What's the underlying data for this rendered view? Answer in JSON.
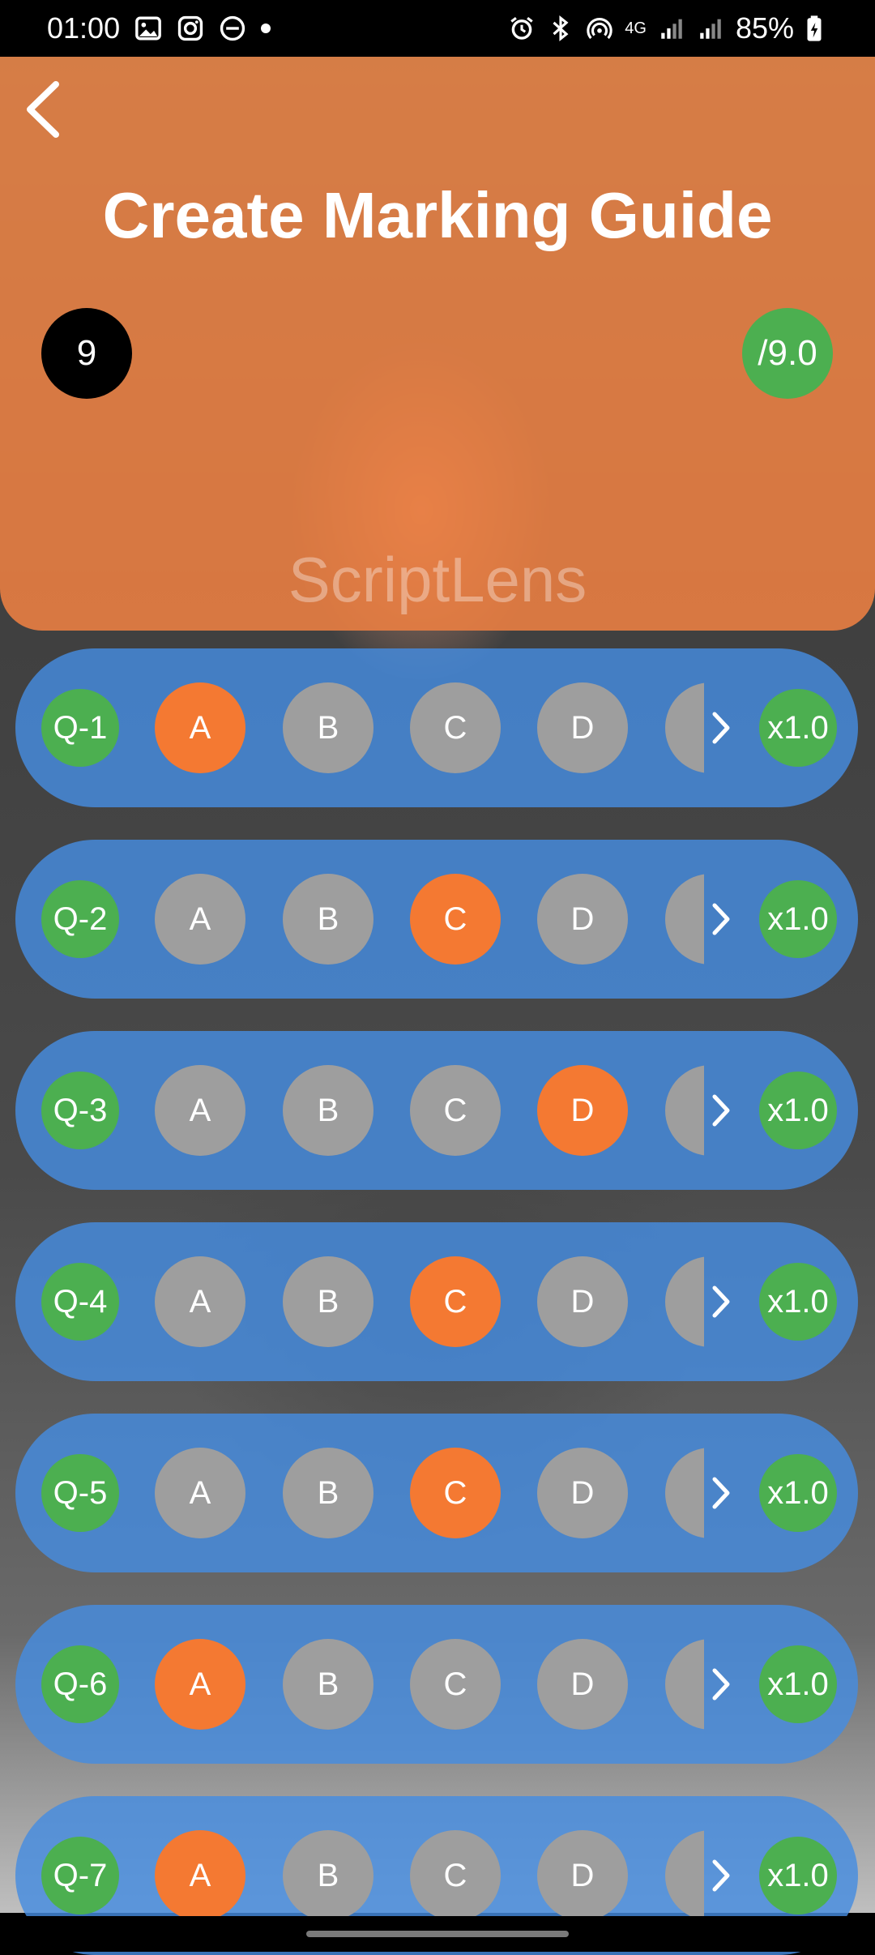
{
  "status_bar": {
    "time": "01:00",
    "network": "4G",
    "battery": "85%"
  },
  "header": {
    "title": "Create Marking Guide",
    "question_count": "9",
    "total_marks": "/9.0",
    "brand": "ScriptLens"
  },
  "colors": {
    "header_bg": "#ED8042",
    "row_bg": "#468CE1",
    "selected_option": "#F47932",
    "unselected_option": "#9E9E9E",
    "badge_green": "#4CAF50"
  },
  "questions": [
    {
      "label": "Q-1",
      "options": [
        "A",
        "B",
        "C",
        "D"
      ],
      "selected": "A",
      "weight": "x1.0"
    },
    {
      "label": "Q-2",
      "options": [
        "A",
        "B",
        "C",
        "D"
      ],
      "selected": "C",
      "weight": "x1.0"
    },
    {
      "label": "Q-3",
      "options": [
        "A",
        "B",
        "C",
        "D"
      ],
      "selected": "D",
      "weight": "x1.0"
    },
    {
      "label": "Q-4",
      "options": [
        "A",
        "B",
        "C",
        "D"
      ],
      "selected": "C",
      "weight": "x1.0"
    },
    {
      "label": "Q-5",
      "options": [
        "A",
        "B",
        "C",
        "D"
      ],
      "selected": "C",
      "weight": "x1.0"
    },
    {
      "label": "Q-6",
      "options": [
        "A",
        "B",
        "C",
        "D"
      ],
      "selected": "A",
      "weight": "x1.0"
    },
    {
      "label": "Q-7",
      "options": [
        "A",
        "B",
        "C",
        "D"
      ],
      "selected": "A",
      "weight": "x1.0"
    }
  ]
}
